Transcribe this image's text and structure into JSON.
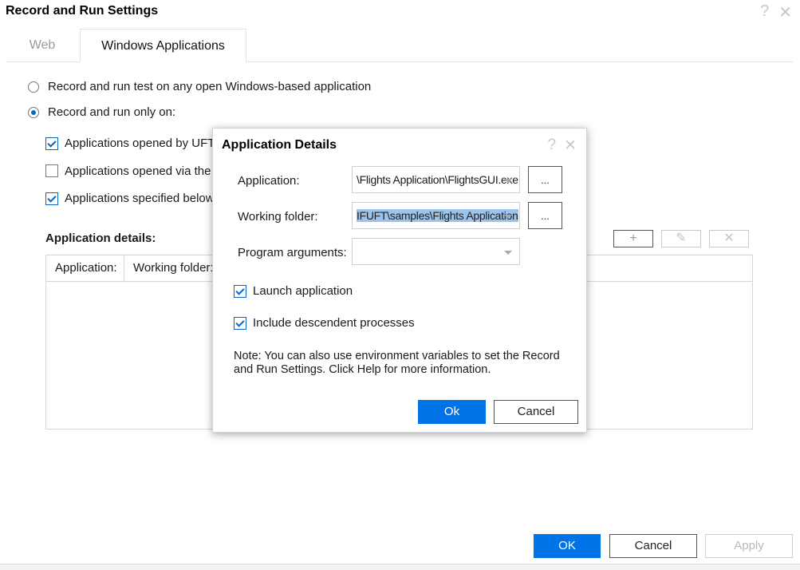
{
  "window": {
    "title": "Record and Run Settings",
    "help_icon": "?",
    "close_icon": "✕"
  },
  "tabs": [
    {
      "label": "Web",
      "active": false
    },
    {
      "label": "Windows Applications",
      "active": true
    }
  ],
  "options": {
    "radio_any": {
      "label": "Record and run test on any open Windows-based application",
      "selected": false
    },
    "radio_only": {
      "label": "Record and run only on:",
      "selected": true
    },
    "check_uft": {
      "label": "Applications opened by UFT",
      "checked": true
    },
    "check_via": {
      "label": "Applications opened via the D",
      "checked": false
    },
    "check_specified": {
      "label": "Applications specified below",
      "checked": true
    }
  },
  "app_details": {
    "heading": "Application details:",
    "columns": [
      "Application:",
      "Working folder:"
    ],
    "toolbar": {
      "add": "+",
      "edit": "✎",
      "delete": "✕"
    }
  },
  "footer": {
    "ok": "OK",
    "cancel": "Cancel",
    "apply": "Apply"
  },
  "dialog": {
    "title": "Application Details",
    "help_icon": "?",
    "close_icon": "✕",
    "application": {
      "label": "Application:",
      "value": "\\Flights Application\\FlightsGUI.exe",
      "browse": "..."
    },
    "working_folder": {
      "label": "Working folder:",
      "value": "IFUFT\\samples\\Flights Application",
      "browse": "..."
    },
    "program_arguments": {
      "label": "Program arguments:",
      "value": ""
    },
    "launch_application": {
      "label": "Launch application",
      "checked": true
    },
    "include_descendent": {
      "label": "Include descendent processes",
      "checked": true
    },
    "note": "Note: You can also use environment variables to set the Record and Run Settings. Click Help for more information.",
    "ok": "Ok",
    "cancel": "Cancel"
  },
  "colors": {
    "accent": "#0073e7",
    "check": "#0a65c4",
    "selection": "#9cc3ec"
  }
}
